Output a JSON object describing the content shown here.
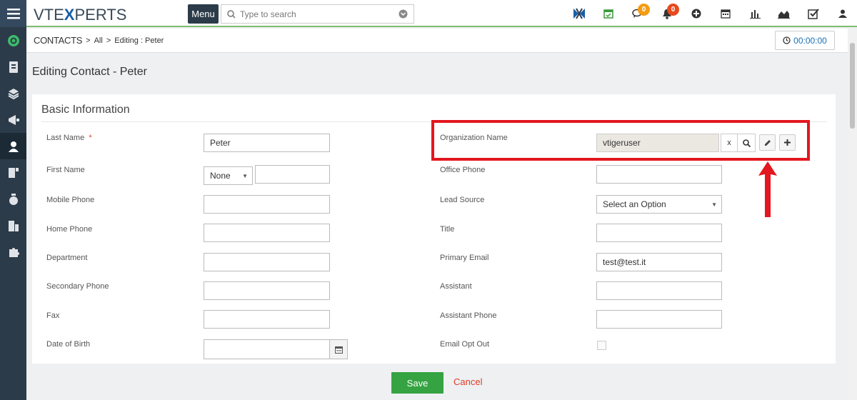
{
  "brand": {
    "logo_left": "VTE",
    "logo_x": "X",
    "logo_right": "PERTS"
  },
  "topbar": {
    "menu_label": "Menu",
    "search_placeholder": "Type to search",
    "badges": {
      "chat": "0",
      "notifications": "0"
    },
    "icons": [
      "vtexperts-icon",
      "calendar-check-icon",
      "chat-icon",
      "bell-icon",
      "plus-circle-icon",
      "calendar-icon",
      "bar-chart-icon",
      "area-chart-icon",
      "task-check-icon",
      "user-icon"
    ]
  },
  "breadcrumb": {
    "module": "CONTACTS",
    "sep1": ">",
    "all": "All",
    "sep2": ">",
    "current": "Editing : Peter"
  },
  "timer": {
    "value": "00:00:00"
  },
  "page": {
    "title": "Editing Contact - Peter"
  },
  "section": {
    "title": "Basic Information"
  },
  "fields": {
    "last_name": {
      "label": "Last Name",
      "required": "*",
      "value": "Peter"
    },
    "first_name": {
      "label": "First Name",
      "salutation": "None",
      "value": ""
    },
    "mobile_phone": {
      "label": "Mobile Phone",
      "value": ""
    },
    "home_phone": {
      "label": "Home Phone",
      "value": ""
    },
    "department": {
      "label": "Department",
      "value": ""
    },
    "secondary_phone": {
      "label": "Secondary Phone",
      "value": ""
    },
    "fax": {
      "label": "Fax",
      "value": ""
    },
    "date_of_birth": {
      "label": "Date of Birth",
      "value": ""
    },
    "organization_name": {
      "label": "Organization Name",
      "value": "vtigeruser",
      "clear": "x"
    },
    "office_phone": {
      "label": "Office Phone",
      "value": ""
    },
    "lead_source": {
      "label": "Lead Source",
      "value": "Select an Option"
    },
    "title": {
      "label": "Title",
      "value": ""
    },
    "primary_email": {
      "label": "Primary Email",
      "value": "test@test.it"
    },
    "assistant": {
      "label": "Assistant",
      "value": ""
    },
    "assistant_phone": {
      "label": "Assistant Phone",
      "value": ""
    },
    "email_opt_out": {
      "label": "Email Opt Out"
    }
  },
  "footer": {
    "save": "Save",
    "cancel": "Cancel"
  },
  "colors": {
    "highlight": "#e3171f",
    "save": "#35a341",
    "rail": "#2c3b49",
    "accent": "#7dbd6f"
  }
}
